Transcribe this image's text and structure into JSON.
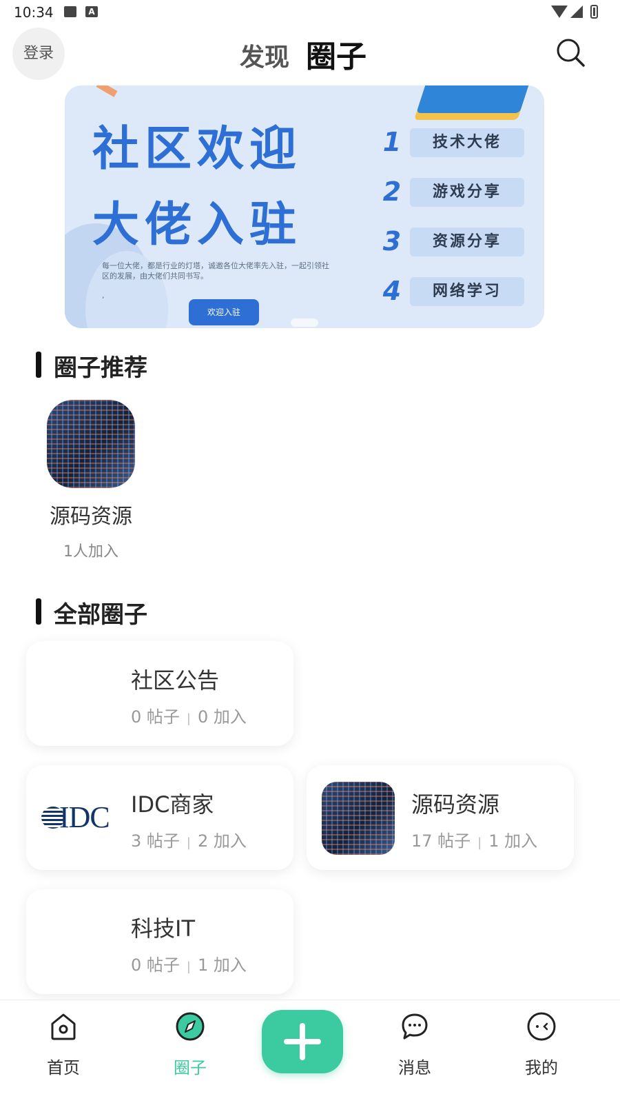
{
  "status_bar": {
    "time": "10:34"
  },
  "header": {
    "login_label": "登录",
    "tab_discover": "发现",
    "tab_circle": "圈子"
  },
  "banner": {
    "headline_line1": "社区欢迎",
    "headline_line2": "大佬入驻",
    "description": "每一位大佬，都是行业的灯塔，诚邀各位大佬率先入驻，一起引领社区的发展，由大佬们共同书写。",
    "cta_label": "欢迎入驻",
    "list": [
      {
        "num": "1",
        "label": "技术大佬"
      },
      {
        "num": "2",
        "label": "游戏分享"
      },
      {
        "num": "3",
        "label": "资源分享"
      },
      {
        "num": "4",
        "label": "网络学习"
      }
    ]
  },
  "recommended": {
    "title": "圈子推荐",
    "items": [
      {
        "name": "源码资源",
        "members": "1人加入"
      }
    ]
  },
  "all_circles": {
    "title": "全部圈子",
    "items": [
      {
        "name": "社区公告",
        "posts": "0 帖子",
        "joins": "0 加入"
      },
      {
        "name": "IDC商家",
        "posts": "3 帖子",
        "joins": "2 加入",
        "logo_text": "IDC"
      },
      {
        "name": "源码资源",
        "posts": "17 帖子",
        "joins": "1 加入"
      },
      {
        "name": "科技IT",
        "posts": "0 帖子",
        "joins": "1 加入"
      }
    ]
  },
  "bottom_nav": {
    "items": [
      {
        "label": "首页",
        "icon": "home-icon"
      },
      {
        "label": "圈子",
        "icon": "compass-icon",
        "active": true
      },
      {
        "label": "消息",
        "icon": "chat-icon"
      },
      {
        "label": "我的",
        "icon": "face-icon"
      }
    ],
    "add_icon": "plus-icon"
  },
  "colors": {
    "accent": "#3ccaa0",
    "banner_blue": "#2d6fd4",
    "banner_bg": "#dde9f8"
  }
}
